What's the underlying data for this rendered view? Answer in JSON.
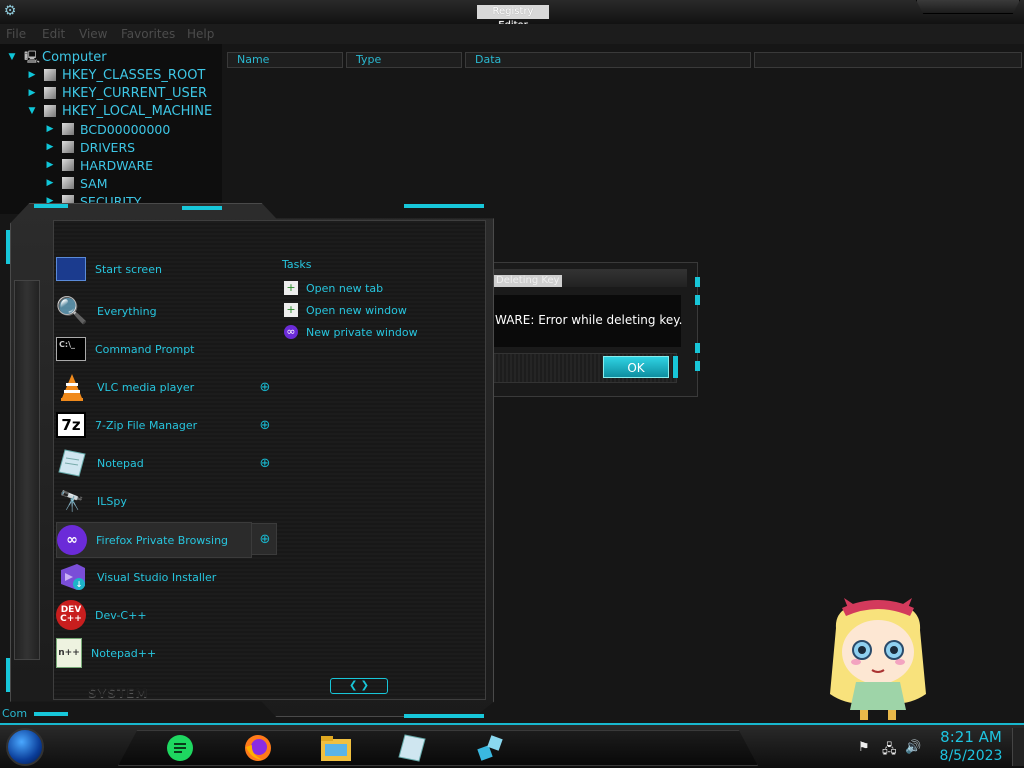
{
  "window": {
    "title": "Registry Editor",
    "menu": [
      "File",
      "Edit",
      "View",
      "Favorites",
      "Help"
    ]
  },
  "tree": {
    "root": "Computer",
    "items": [
      "HKEY_CLASSES_ROOT",
      "HKEY_CURRENT_USER",
      "HKEY_LOCAL_MACHINE"
    ],
    "children": [
      "BCD00000000",
      "DRIVERS",
      "HARDWARE",
      "SAM",
      "SECURITY"
    ]
  },
  "list": {
    "columns": [
      "Name",
      "Type",
      "Data"
    ]
  },
  "dialog": {
    "title": "Deleting Key",
    "message": "WARE:  Error while deleting key.",
    "ok_label": "OK"
  },
  "start_menu": {
    "programs": [
      {
        "label": "Start screen",
        "icon": "start-screen-icon"
      },
      {
        "label": "Everything",
        "icon": "everything-search-icon"
      },
      {
        "label": "Command Prompt",
        "icon": "command-prompt-icon"
      },
      {
        "label": "VLC media player",
        "icon": "vlc-cone-icon"
      },
      {
        "label": "7-Zip File Manager",
        "icon": "7zip-icon"
      },
      {
        "label": "Notepad",
        "icon": "notepad-icon"
      },
      {
        "label": "ILSpy",
        "icon": "ilspy-icon"
      },
      {
        "label": "Firefox Private Browsing",
        "icon": "firefox-private-icon"
      },
      {
        "label": "Visual Studio Installer",
        "icon": "visual-studio-installer-icon"
      },
      {
        "label": "Dev-C++",
        "icon": "dev-cpp-icon"
      },
      {
        "label": "Notepad++",
        "icon": "notepad-plus-plus-icon"
      }
    ],
    "tasks_heading": "Tasks",
    "tasks": [
      "Open new tab",
      "Open new window",
      "New private window"
    ],
    "footer_label": "SYSTEM"
  },
  "taskbar": {
    "apps": [
      "notes-app-icon",
      "firefox-icon",
      "file-explorer-icon",
      "notepad-icon",
      "registry-editor-icon"
    ],
    "time": "8:21 AM",
    "date": "8/5/2023",
    "status_fragment": "Com"
  },
  "colors": {
    "accent": "#17c7da",
    "background": "#161616"
  }
}
